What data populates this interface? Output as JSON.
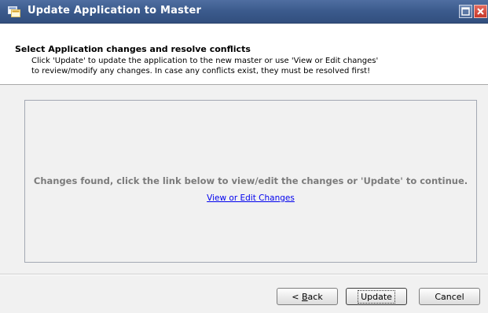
{
  "window": {
    "title": "Update Application to Master"
  },
  "header": {
    "heading": "Select Application changes and resolve conflicts",
    "description_line1": "Click 'Update' to update the application to the new master or use 'View or Edit changes'",
    "description_line2": "to review/modify any changes. In case any conflicts exist, they must be resolved first!"
  },
  "content": {
    "message": "Changes found, click the link below to view/edit the changes or 'Update' to continue.",
    "link_label": "View or Edit Changes"
  },
  "footer": {
    "back_prefix": "< ",
    "back_mnemonic": "B",
    "back_rest": "ack",
    "update_label": "Update",
    "cancel_label": "Cancel"
  },
  "icons": {
    "app": "application-icon",
    "maximize": "maximize-icon",
    "close": "close-icon"
  },
  "colors": {
    "titlebar": "#3b5a8c",
    "close": "#c8382a",
    "link": "#0000ee",
    "message": "#7b7b7b"
  }
}
